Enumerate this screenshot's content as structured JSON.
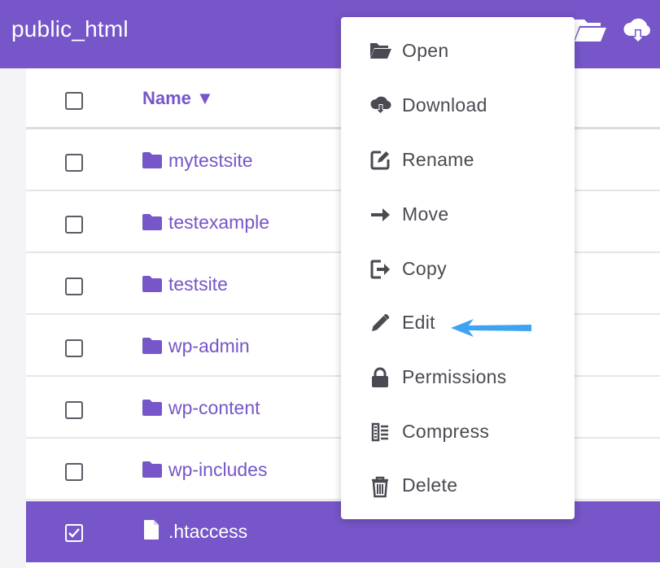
{
  "header": {
    "title": "public_html",
    "icons": [
      "folder-open-icon",
      "cloud-download-icon"
    ]
  },
  "table": {
    "column_name": "Name ▼",
    "rows": [
      {
        "name": "mytestsite",
        "type": "folder",
        "checked": false
      },
      {
        "name": "testexample",
        "type": "folder",
        "checked": false
      },
      {
        "name": "testsite",
        "type": "folder",
        "checked": false
      },
      {
        "name": "wp-admin",
        "type": "folder",
        "checked": false
      },
      {
        "name": "wp-content",
        "type": "folder",
        "checked": false
      },
      {
        "name": "wp-includes",
        "type": "folder",
        "checked": false
      },
      {
        "name": ".htaccess",
        "type": "file",
        "checked": true
      }
    ]
  },
  "context_menu": {
    "items": [
      {
        "label": "Open",
        "icon": "folder-open-icon"
      },
      {
        "label": "Download",
        "icon": "cloud-download-icon"
      },
      {
        "label": "Rename",
        "icon": "rename-icon"
      },
      {
        "label": "Move",
        "icon": "arrow-right-icon"
      },
      {
        "label": "Copy",
        "icon": "copy-icon"
      },
      {
        "label": "Edit",
        "icon": "pencil-icon"
      },
      {
        "label": "Permissions",
        "icon": "lock-icon"
      },
      {
        "label": "Compress",
        "icon": "compress-icon"
      },
      {
        "label": "Delete",
        "icon": "trash-icon"
      }
    ]
  },
  "colors": {
    "accent": "#7656c8",
    "menu_text": "#4a4a52",
    "pointer_arrow": "#3ea3f0"
  }
}
